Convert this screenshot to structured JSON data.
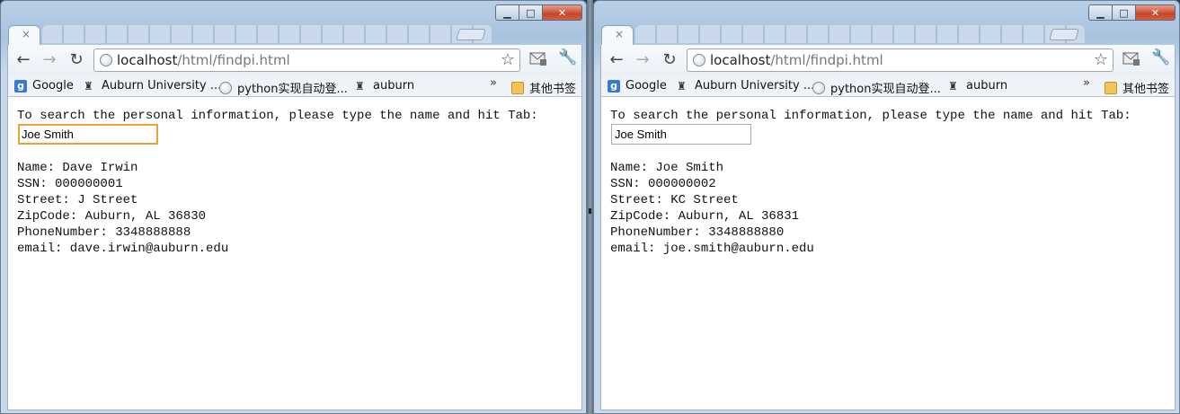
{
  "windows": [
    {
      "tab_close": "×",
      "address": {
        "host": "localhost",
        "path": "/html/findpi.html"
      },
      "bookmarks": [
        {
          "label": "Google",
          "icon": "google-icon"
        },
        {
          "label": "Auburn University ...",
          "icon": "auburn-icon"
        },
        {
          "label": "python实现自动登...",
          "icon": "globe-icon"
        },
        {
          "label": "auburn",
          "icon": "auburn-icon"
        }
      ],
      "bookmarks_overflow": "»",
      "other_bookmarks": "其他书签",
      "page": {
        "prompt": "To search the personal information, please type the name and hit Tab:",
        "input_value": "Joe Smith",
        "name": "Name: Dave Irwin",
        "ssn": "SSN: 000000001",
        "street": "Street: J Street",
        "zip": "ZipCode: Auburn, AL 36830",
        "phone": "PhoneNumber: 3348888888",
        "email": "email: dave.irwin@auburn.edu"
      }
    },
    {
      "tab_close": "×",
      "address": {
        "host": "localhost",
        "path": "/html/findpi.html"
      },
      "bookmarks": [
        {
          "label": "Google",
          "icon": "google-icon"
        },
        {
          "label": "Auburn University ...",
          "icon": "auburn-icon"
        },
        {
          "label": "python实现自动登...",
          "icon": "globe-icon"
        },
        {
          "label": "auburn",
          "icon": "auburn-icon"
        }
      ],
      "bookmarks_overflow": "»",
      "other_bookmarks": "其他书签",
      "page": {
        "prompt": "To search the personal information, please type the name and hit Tab:",
        "input_value": "Joe Smith",
        "name": "Name: Joe Smith",
        "ssn": "SSN: 000000002",
        "street": "Street: KC Street",
        "zip": "ZipCode: Auburn, AL 36831",
        "phone": "PhoneNumber: 3348888880",
        "email": "email: joe.smith@auburn.edu"
      }
    }
  ],
  "colors": {
    "focus_ring": "#e8a33a",
    "close_button": "#c6452b"
  }
}
